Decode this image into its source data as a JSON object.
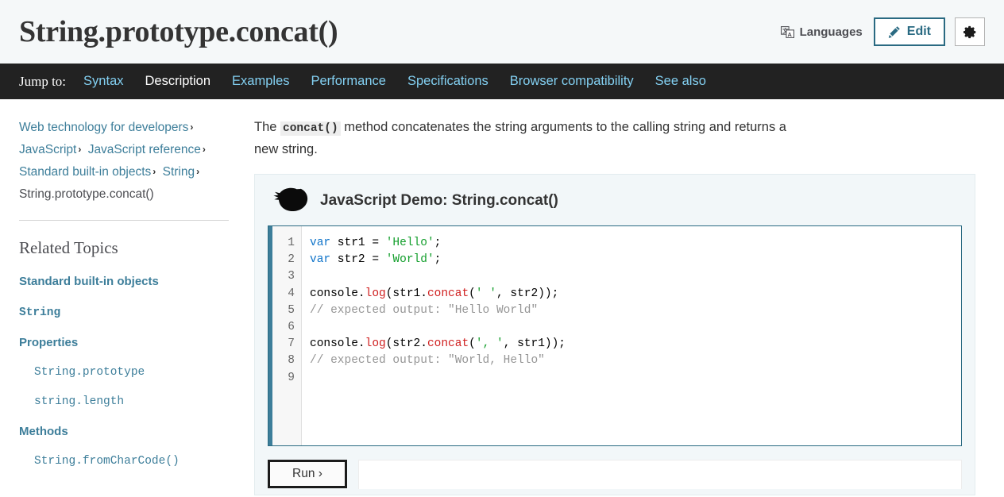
{
  "header": {
    "title": "String.prototype.concat()",
    "languages_label": "Languages",
    "languages_icon": "translate-icon",
    "edit_label": "Edit",
    "edit_icon": "pencil-icon",
    "settings_icon": "gear-icon",
    "background": "#f5f8f9"
  },
  "jumpbar": {
    "label": "Jump to:",
    "background": "#222222",
    "link_color": "#83d0f2",
    "current_color": "#ffffff",
    "links": [
      {
        "label": "Syntax",
        "current": false
      },
      {
        "label": "Description",
        "current": true
      },
      {
        "label": "Examples",
        "current": false
      },
      {
        "label": "Performance",
        "current": false
      },
      {
        "label": "Specifications",
        "current": false
      },
      {
        "label": "Browser compatibility",
        "current": false
      },
      {
        "label": "See also",
        "current": false
      }
    ]
  },
  "breadcrumb": {
    "separator": "›",
    "items": [
      {
        "label": "Web technology for developers",
        "link": true
      },
      {
        "label": "JavaScript",
        "link": true
      },
      {
        "label": "JavaScript reference",
        "link": true
      },
      {
        "label": "Standard built-in objects",
        "link": true
      },
      {
        "label": "String",
        "link": true
      },
      {
        "label": "String.prototype.concat()",
        "link": false
      }
    ]
  },
  "sidebar": {
    "related_heading": "Related Topics",
    "items": [
      {
        "label": "Standard built-in objects",
        "style": "bold",
        "sub": false
      },
      {
        "label": "String",
        "style": "bold-mono",
        "sub": false
      },
      {
        "label": "Properties",
        "style": "bold",
        "sub": false
      },
      {
        "label": "String.prototype",
        "style": "mono",
        "sub": true
      },
      {
        "label": "string.length",
        "style": "mono",
        "sub": true
      },
      {
        "label": "Methods",
        "style": "bold",
        "sub": false
      },
      {
        "label": "String.fromCharCode()",
        "style": "mono",
        "sub": true
      }
    ]
  },
  "main": {
    "intro_before": "The ",
    "intro_code": "concat()",
    "intro_after": " method concatenates the string arguments to the calling string and returns a new string.",
    "demo": {
      "logo_icon": "mdn-dino-icon",
      "title": "JavaScript Demo: String.concat()",
      "run_label": "Run ›",
      "accent_color": "#3d7e9a",
      "panel_background": "#f2f7f9",
      "code_lines": [
        {
          "n": "1",
          "tokens": [
            {
              "t": "var",
              "c": "kw"
            },
            {
              "t": " str1 = ",
              "c": ""
            },
            {
              "t": "'Hello'",
              "c": "str"
            },
            {
              "t": ";",
              "c": ""
            }
          ]
        },
        {
          "n": "2",
          "tokens": [
            {
              "t": "var",
              "c": "kw"
            },
            {
              "t": " str2 = ",
              "c": ""
            },
            {
              "t": "'World'",
              "c": "str"
            },
            {
              "t": ";",
              "c": ""
            }
          ]
        },
        {
          "n": "3",
          "tokens": []
        },
        {
          "n": "4",
          "tokens": [
            {
              "t": "console.",
              "c": ""
            },
            {
              "t": "log",
              "c": "fn"
            },
            {
              "t": "(str1.",
              "c": ""
            },
            {
              "t": "concat",
              "c": "fn"
            },
            {
              "t": "(",
              "c": ""
            },
            {
              "t": "' '",
              "c": "str"
            },
            {
              "t": ", str2));",
              "c": ""
            }
          ]
        },
        {
          "n": "5",
          "tokens": [
            {
              "t": "// expected output: \"Hello World\"",
              "c": "com"
            }
          ]
        },
        {
          "n": "6",
          "tokens": []
        },
        {
          "n": "7",
          "tokens": [
            {
              "t": "console.",
              "c": ""
            },
            {
              "t": "log",
              "c": "fn"
            },
            {
              "t": "(str2.",
              "c": ""
            },
            {
              "t": "concat",
              "c": "fn"
            },
            {
              "t": "(",
              "c": ""
            },
            {
              "t": "', '",
              "c": "str"
            },
            {
              "t": ", str1));",
              "c": ""
            }
          ]
        },
        {
          "n": "8",
          "tokens": [
            {
              "t": "// expected output: \"World, Hello\"",
              "c": "com"
            }
          ]
        },
        {
          "n": "9",
          "tokens": []
        }
      ]
    }
  }
}
